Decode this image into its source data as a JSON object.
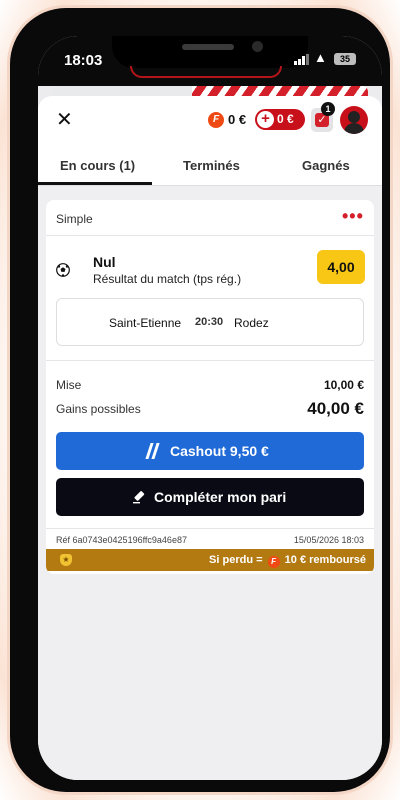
{
  "status_bar": {
    "time": "18:03",
    "battery": "35"
  },
  "header": {
    "close_glyph": "✕",
    "fpoints_symbol": "F",
    "fpoints": "0 €",
    "bonus_symbol": "+",
    "bonus": "0 €",
    "betslip_count": "1"
  },
  "tabs": [
    {
      "label": "En cours (1)",
      "active": true
    },
    {
      "label": "Terminés",
      "active": false
    },
    {
      "label": "Gagnés",
      "active": false
    }
  ],
  "bet": {
    "type": "Simple",
    "more_glyph": "•••",
    "selection": "Nul",
    "market": "Résultat du match (tps rég.)",
    "odds": "4,00",
    "home_team": "Saint-Etienne",
    "kickoff": "20:30",
    "away_team": "Rodez",
    "stake_label": "Mise",
    "stake": "10,00 €",
    "potential_label": "Gains possibles",
    "potential": "40,00 €",
    "cashout_label": "Cashout 9,50 €",
    "complete_label": "Compléter mon pari",
    "ref": "Réf 6a0743e0425196ffc9a46e87",
    "date": "15/05/2026 18:03",
    "refund_prefix": "Si perdu =",
    "refund_suffix": "10 € remboursé",
    "refund_coin": "F"
  },
  "colors": {
    "brand_red": "#d4202a",
    "odds_yellow": "#f8c715",
    "cashout_blue": "#1f6ad6",
    "refund_gold": "#b47a12"
  }
}
